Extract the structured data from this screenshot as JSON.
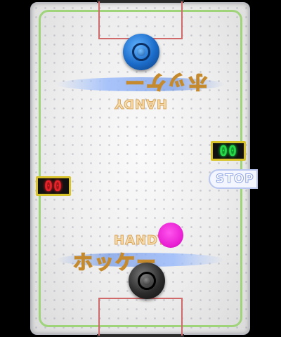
{
  "game": {
    "title_jp": "ホッケー",
    "title_en": "HANDY"
  },
  "scores": {
    "top_player": "00",
    "bottom_player": "00"
  },
  "controls": {
    "stop_label": "STOP"
  },
  "colors": {
    "rink_line": "#9fd47a",
    "goal_box": "#d06a6a",
    "top_mallet": "#1b6bc9",
    "bottom_mallet": "#2c2c2c",
    "puck": "#e81fd2",
    "score_top": "#27d84a",
    "score_bottom": "#e8222a"
  }
}
